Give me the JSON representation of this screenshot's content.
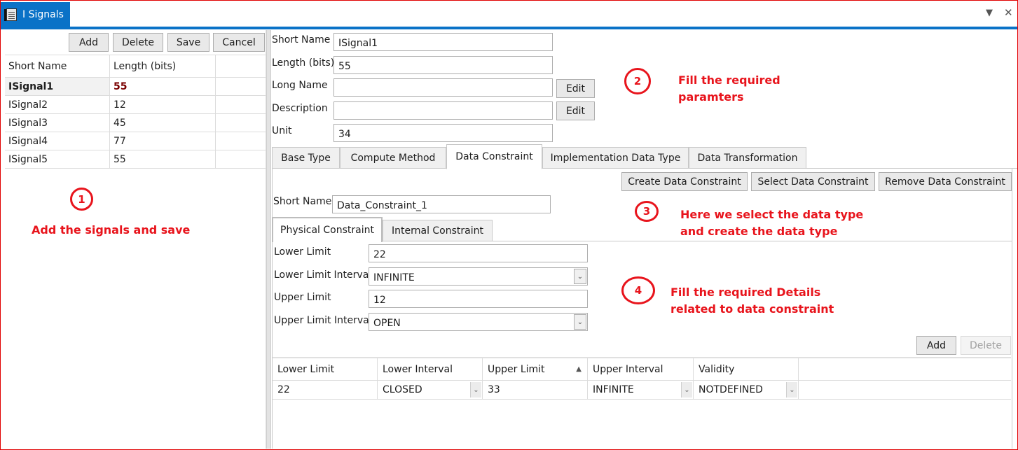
{
  "window": {
    "title": "I Signals",
    "icons": {
      "app": "document-icon",
      "menu": "dropdown-arrow-icon",
      "close": "close-icon"
    },
    "accent_color": "#0a72c7"
  },
  "left": {
    "toolbar": {
      "add": "Add",
      "delete": "Delete",
      "save": "Save",
      "cancel": "Cancel"
    },
    "grid": {
      "headers": [
        "Short Name",
        "Length (bits)",
        ""
      ],
      "rows": [
        {
          "name": "ISignal1",
          "length": "55",
          "selected": true
        },
        {
          "name": "ISignal2",
          "length": "12"
        },
        {
          "name": "ISignal3",
          "length": "45"
        },
        {
          "name": "ISignal4",
          "length": "77"
        },
        {
          "name": "ISignal5",
          "length": "55"
        }
      ]
    }
  },
  "form": {
    "short_name_label": "Short Name",
    "short_name_value": "ISignal1",
    "length_label": "Length (bits)",
    "length_value": "55",
    "long_name_label": "Long Name",
    "long_name_value": "",
    "description_label": "Description",
    "description_value": "",
    "unit_label": "Unit",
    "unit_value": "34",
    "edit_label": "Edit"
  },
  "tabs": [
    {
      "label": "Base Type"
    },
    {
      "label": "Compute Method"
    },
    {
      "label": "Data Constraint",
      "active": true
    },
    {
      "label": "Implementation Data Type"
    },
    {
      "label": "Data Transformation"
    }
  ],
  "constraint": {
    "create": "Create Data Constraint",
    "select": "Select Data Constraint",
    "remove": "Remove Data Constraint",
    "short_name_label": "Short Name",
    "short_name_value": "Data_Constraint_1",
    "subtabs": [
      {
        "label": "Physical Constraint",
        "active": true
      },
      {
        "label": "Internal Constraint"
      }
    ],
    "lower_limit_label": "Lower Limit",
    "lower_limit_value": "22",
    "lower_interval_label": "Lower Limit Interval",
    "lower_interval_value": "INFINITE",
    "upper_limit_label": "Upper Limit",
    "upper_limit_value": "12",
    "upper_interval_label": "Upper Limit Interval",
    "upper_interval_value": "OPEN",
    "add": "Add",
    "delete": "Delete",
    "grid": {
      "headers": [
        "Lower Limit",
        "Lower Interval",
        "Upper Limit",
        "Upper Interval",
        "Validity"
      ],
      "sorted_column": "Upper Limit",
      "sort_direction": "ascending",
      "rows": [
        {
          "lower_limit": "22",
          "lower_interval": "CLOSED",
          "upper_limit": "33",
          "upper_interval": "INFINITE",
          "validity": "NOTDEFINED"
        }
      ]
    }
  },
  "annotations": [
    {
      "number": "1",
      "text": "Add the signals and save"
    },
    {
      "number": "2",
      "text": "Fill the required paramters"
    },
    {
      "number": "3",
      "text": "Here we select the data type and create the data type"
    },
    {
      "number": "4",
      "text": "Fill the required Details related to data constraint"
    }
  ],
  "annotation_color": "#e8141c"
}
